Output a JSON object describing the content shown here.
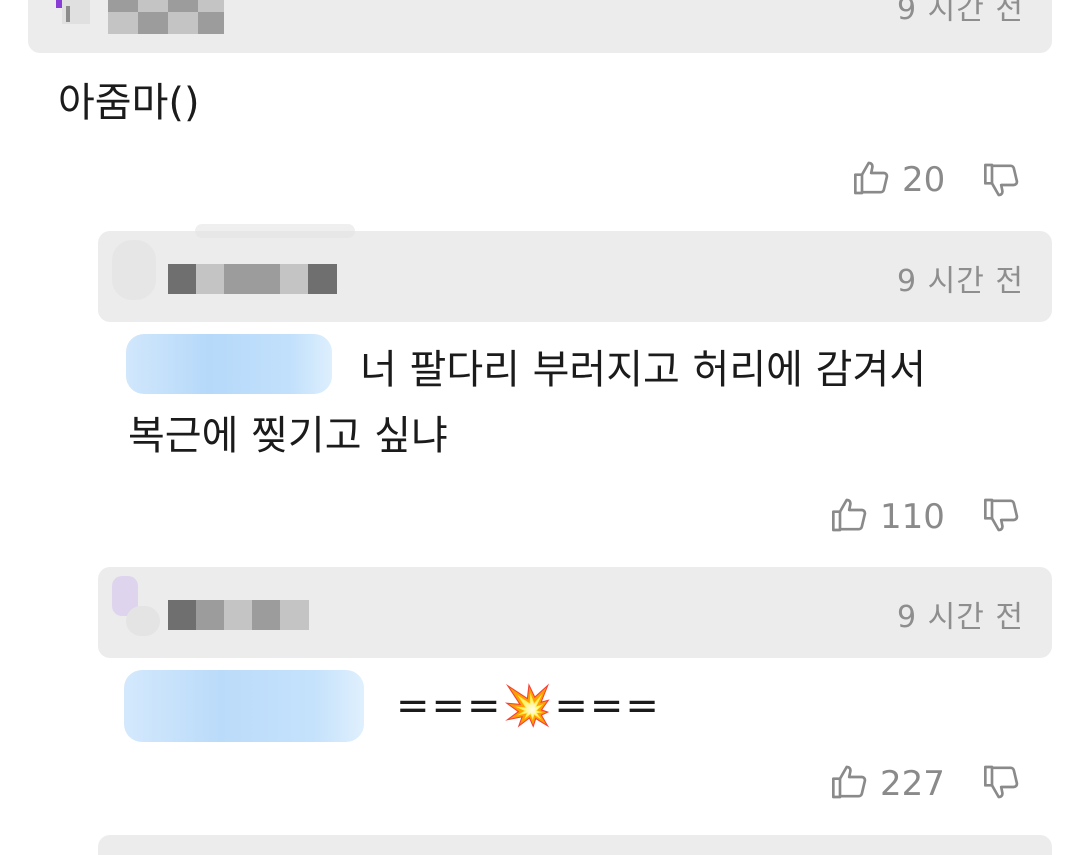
{
  "comments": [
    {
      "time": "9 시간 전",
      "text": "아줌마()",
      "likes": "20"
    },
    {
      "time": "9 시간 전",
      "text_line1": "너 팔다리 부러지고 허리에 감겨서",
      "text_line2": "복근에 찢기고 싶냐",
      "likes": "110"
    },
    {
      "time": "9 시간 전",
      "text_prefix": "===",
      "emoji": "💥",
      "text_suffix": "===",
      "likes": "227"
    }
  ],
  "icons": {
    "like": "thumbs-up-icon",
    "dislike": "thumbs-down-icon"
  },
  "colors": {
    "header_bg": "#ececec",
    "meta_text": "#8e8e8e",
    "mention_blur": "#a9d2f9"
  }
}
